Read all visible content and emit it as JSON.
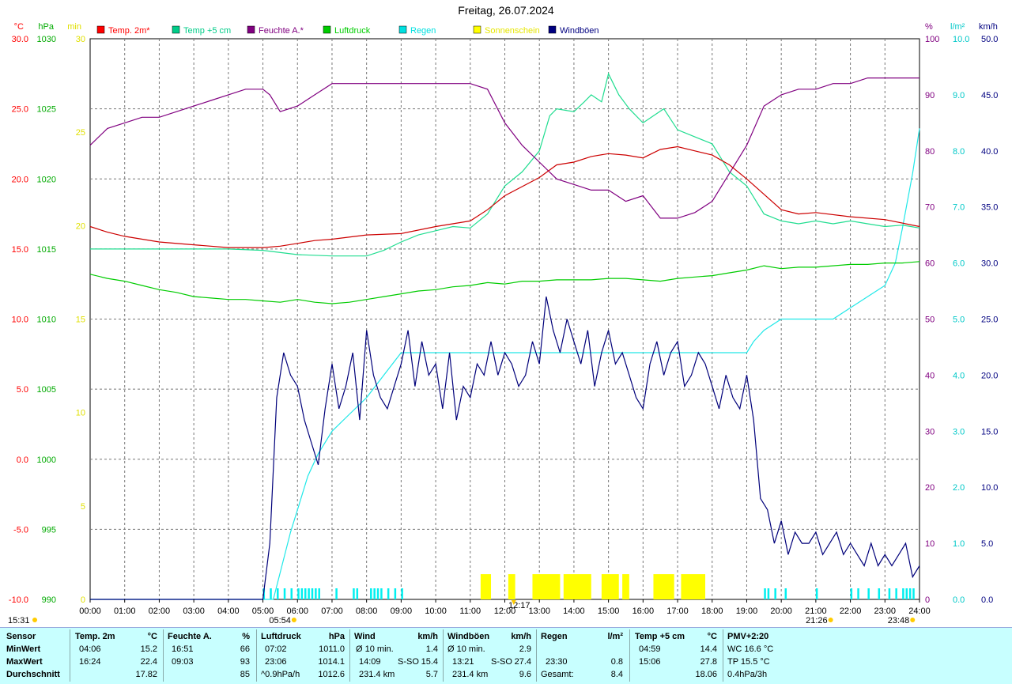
{
  "title": "Freitag, 26.07.2024",
  "chart_data": {
    "type": "line",
    "x_ticks": [
      "00:00",
      "01:00",
      "02:00",
      "03:00",
      "04:00",
      "05:00",
      "06:00",
      "07:00",
      "08:00",
      "09:00",
      "10:00",
      "11:00",
      "12:00",
      "13:00",
      "14:00",
      "15:00",
      "16:00",
      "17:00",
      "18:00",
      "19:00",
      "20:00",
      "21:00",
      "22:00",
      "23:00",
      "24:00"
    ],
    "axes": {
      "temp": {
        "unit": "°C",
        "color": "#ff0000",
        "min": -10,
        "max": 30,
        "step": 5,
        "ticks": [
          "-10.0",
          "-5.0",
          "0.0",
          "5.0",
          "10.0",
          "15.0",
          "20.0",
          "25.0",
          "30.0"
        ]
      },
      "pressure": {
        "unit": "hPa",
        "color": "#00aa00",
        "min": 990,
        "max": 1030,
        "step": 5,
        "ticks": [
          "990",
          "995",
          "1000",
          "1005",
          "1010",
          "1015",
          "1020",
          "1025",
          "1030"
        ]
      },
      "sun": {
        "unit": "min",
        "color": "#ffff00",
        "min": 0,
        "max": 30,
        "step": 5,
        "ticks": [
          "0",
          "5",
          "10",
          "15",
          "20",
          "25",
          "30"
        ]
      },
      "humidity": {
        "unit": "%",
        "color": "#800080",
        "min": 0,
        "max": 100,
        "step": 10,
        "ticks": [
          "0",
          "10",
          "20",
          "30",
          "40",
          "50",
          "60",
          "70",
          "80",
          "90",
          "100"
        ]
      },
      "rain": {
        "unit": "l/m²",
        "color": "#00e0e0",
        "min": 0,
        "max": 10,
        "step": 1,
        "ticks": [
          "0.0",
          "1.0",
          "2.0",
          "3.0",
          "4.0",
          "5.0",
          "6.0",
          "7.0",
          "8.0",
          "9.0",
          "10.0"
        ]
      },
      "wind": {
        "unit": "km/h",
        "color": "#000080",
        "min": 0,
        "max": 50,
        "step": 5,
        "ticks": [
          "0.0",
          "5.0",
          "10.0",
          "15.0",
          "20.0",
          "25.0",
          "30.0",
          "35.0",
          "40.0",
          "45.0",
          "50.0"
        ]
      }
    },
    "legend": [
      {
        "name": "Temp. 2m*",
        "color": "#ff0000"
      },
      {
        "name": "Temp +5 cm",
        "color": "#00cc88"
      },
      {
        "name": "Feuchte A.*",
        "color": "#800080"
      },
      {
        "name": "Luftdruck",
        "color": "#00cc00"
      },
      {
        "name": "Regen",
        "color": "#00e0e0"
      },
      {
        "name": "Sonnenschein",
        "color": "#ffff00"
      },
      {
        "name": "Windböen",
        "color": "#000080"
      }
    ],
    "series": {
      "temp2m": {
        "axis": "temp",
        "color": "#cc0000",
        "x": [
          0,
          0.5,
          1,
          2,
          3,
          4,
          4.5,
          5,
          5.5,
          6,
          6.5,
          7,
          8,
          9,
          10,
          11,
          11.5,
          12,
          13,
          13.5,
          14,
          14.5,
          15,
          15.5,
          16,
          16.5,
          17,
          17.5,
          18,
          18.5,
          19,
          19.5,
          20,
          20.5,
          21,
          22,
          23,
          24
        ],
        "y": [
          16.6,
          16.2,
          15.9,
          15.5,
          15.3,
          15.1,
          15.1,
          15.1,
          15.2,
          15.4,
          15.6,
          15.7,
          16.0,
          16.1,
          16.6,
          17.0,
          17.8,
          18.8,
          20.1,
          21.0,
          21.2,
          21.6,
          21.8,
          21.7,
          21.5,
          22.1,
          22.3,
          22.0,
          21.7,
          21.0,
          20.0,
          18.9,
          17.8,
          17.5,
          17.6,
          17.3,
          17.1,
          16.6
        ]
      },
      "temp5cm": {
        "axis": "temp",
        "color": "#20dd90",
        "x": [
          0,
          1,
          2,
          3,
          4,
          5,
          6,
          7,
          8,
          8.5,
          9,
          9.5,
          10,
          10.5,
          11,
          11.5,
          12,
          12.5,
          13,
          13.3,
          13.5,
          14,
          14.3,
          14.5,
          14.8,
          15,
          15.3,
          15.6,
          16,
          16.3,
          16.6,
          17,
          17.5,
          18,
          18.5,
          19,
          19.5,
          20,
          20.5,
          21,
          21.5,
          22,
          22.5,
          23,
          23.5,
          24
        ],
        "y": [
          15.0,
          15.0,
          15.0,
          15.0,
          15.0,
          14.9,
          14.6,
          14.5,
          14.5,
          14.9,
          15.5,
          16.0,
          16.3,
          16.6,
          16.5,
          17.5,
          19.5,
          20.5,
          22.0,
          24.5,
          25.0,
          24.8,
          25.5,
          26.0,
          25.5,
          27.5,
          26.0,
          25.0,
          24.0,
          24.5,
          25.0,
          23.5,
          23.0,
          22.5,
          20.5,
          19.5,
          17.5,
          17.0,
          16.8,
          17.0,
          16.8,
          17.0,
          16.8,
          16.6,
          16.7,
          16.5
        ]
      },
      "humidity": {
        "axis": "humidity",
        "color": "#800080",
        "x": [
          0,
          0.5,
          1,
          1.5,
          2,
          2.5,
          3,
          3.5,
          4,
          4.5,
          5,
          5.2,
          5.5,
          6,
          6.5,
          7,
          7.5,
          8,
          8.5,
          9,
          9.5,
          10,
          10.5,
          11,
          11.5,
          12,
          12.5,
          13,
          13.5,
          14,
          14.5,
          15,
          15.5,
          16,
          16.5,
          17,
          17.5,
          18,
          18.5,
          19,
          19.5,
          20,
          20.5,
          21,
          21.5,
          22,
          22.5,
          23,
          23.5,
          24
        ],
        "y": [
          81,
          84,
          85,
          86,
          86,
          87,
          88,
          89,
          90,
          91,
          91,
          90,
          87,
          88,
          90,
          92,
          92,
          92,
          92,
          92,
          92,
          92,
          92,
          92,
          91,
          85,
          81,
          78,
          75,
          74,
          73,
          73,
          71,
          72,
          68,
          68,
          69,
          71,
          76,
          81,
          88,
          90,
          91,
          91,
          92,
          92,
          93,
          93,
          93,
          93
        ]
      },
      "pressure": {
        "axis": "pressure",
        "color": "#00cc00",
        "x": [
          0,
          0.5,
          1,
          1.5,
          2,
          2.5,
          3,
          3.5,
          4,
          4.5,
          5,
          5.5,
          6,
          6.5,
          7,
          7.5,
          8,
          8.5,
          9,
          9.5,
          10,
          10.5,
          11,
          11.5,
          12,
          12.5,
          13,
          13.5,
          14,
          14.5,
          15,
          15.5,
          16,
          16.5,
          17,
          17.5,
          18,
          18.5,
          19,
          19.5,
          20,
          20.5,
          21,
          21.5,
          22,
          22.5,
          23,
          23.5,
          24
        ],
        "y": [
          1013.2,
          1012.9,
          1012.7,
          1012.4,
          1012.1,
          1011.9,
          1011.6,
          1011.5,
          1011.4,
          1011.4,
          1011.3,
          1011.2,
          1011.4,
          1011.2,
          1011.1,
          1011.2,
          1011.4,
          1011.6,
          1011.8,
          1012.0,
          1012.1,
          1012.3,
          1012.4,
          1012.6,
          1012.5,
          1012.7,
          1012.7,
          1012.8,
          1012.8,
          1012.8,
          1012.9,
          1012.9,
          1012.8,
          1012.7,
          1012.9,
          1013.0,
          1013.1,
          1013.3,
          1013.5,
          1013.8,
          1013.6,
          1013.7,
          1013.7,
          1013.8,
          1013.9,
          1013.9,
          1014.0,
          1014.0,
          1014.1
        ]
      },
      "rain": {
        "axis": "rain",
        "color": "#20e8e8",
        "x": [
          0,
          5.3,
          5.8,
          6,
          6.3,
          6.6,
          7,
          7.5,
          8,
          8.5,
          9,
          11,
          12,
          14,
          16,
          17,
          18,
          19,
          19.2,
          19.5,
          20,
          20.5,
          21,
          21.5,
          22,
          22.5,
          23,
          23.3,
          23.5,
          23.8,
          24
        ],
        "y": [
          0,
          0,
          1.2,
          1.6,
          2.2,
          2.6,
          3.0,
          3.3,
          3.6,
          4.0,
          4.4,
          4.4,
          4.4,
          4.4,
          4.4,
          4.4,
          4.4,
          4.4,
          4.6,
          4.8,
          5.0,
          5.0,
          5.0,
          5.0,
          5.2,
          5.4,
          5.6,
          6.0,
          6.6,
          7.6,
          8.4
        ]
      },
      "wind": {
        "axis": "wind",
        "color": "#00007a",
        "x": [
          0,
          5,
          5.2,
          5.4,
          5.6,
          5.8,
          6,
          6.2,
          6.4,
          6.6,
          6.8,
          7,
          7.2,
          7.4,
          7.6,
          7.8,
          8,
          8.2,
          8.4,
          8.6,
          8.8,
          9,
          9.2,
          9.4,
          9.6,
          9.8,
          10,
          10.2,
          10.4,
          10.6,
          10.8,
          11,
          11.2,
          11.4,
          11.6,
          11.8,
          12,
          12.2,
          12.4,
          12.6,
          12.8,
          13,
          13.2,
          13.4,
          13.6,
          13.8,
          14,
          14.2,
          14.4,
          14.6,
          14.8,
          15,
          15.2,
          15.4,
          15.6,
          15.8,
          16,
          16.2,
          16.4,
          16.6,
          16.8,
          17,
          17.2,
          17.4,
          17.6,
          17.8,
          18,
          18.2,
          18.4,
          18.6,
          18.8,
          19,
          19.2,
          19.4,
          19.6,
          19.8,
          20,
          20.2,
          20.4,
          20.6,
          20.8,
          21,
          21.2,
          21.4,
          21.6,
          21.8,
          22,
          22.2,
          22.4,
          22.6,
          22.8,
          23,
          23.2,
          23.4,
          23.6,
          23.8,
          24
        ],
        "y": [
          0,
          0,
          5,
          18,
          22,
          20,
          19,
          16,
          14,
          12,
          17,
          21,
          17,
          19,
          22,
          16,
          24,
          20,
          18,
          17,
          19,
          21,
          24,
          19,
          23,
          20,
          21,
          17,
          22,
          16,
          19,
          18,
          21,
          20,
          23,
          20,
          22,
          21,
          19,
          20,
          23,
          21,
          27,
          24,
          22,
          25,
          23,
          21,
          24,
          19,
          22,
          24,
          21,
          22,
          20,
          18,
          17,
          21,
          23,
          20,
          22,
          23,
          19,
          20,
          22,
          21,
          19,
          17,
          20,
          18,
          17,
          20,
          16,
          9,
          8,
          5,
          7,
          4,
          6,
          5,
          5,
          6,
          4,
          5,
          6,
          4,
          5,
          4,
          3,
          5,
          3,
          4,
          3,
          4,
          5,
          2,
          3,
          2
        ]
      }
    },
    "sunshine_intervals": [
      [
        11.3,
        11.6
      ],
      [
        12.1,
        12.3
      ],
      [
        12.8,
        13.6
      ],
      [
        13.7,
        14.5
      ],
      [
        14.8,
        15.3
      ],
      [
        15.4,
        15.6
      ],
      [
        16.3,
        16.9
      ],
      [
        17.1,
        17.8
      ]
    ],
    "rain_ticks": [
      5.0,
      5.2,
      5.4,
      5.6,
      5.8,
      6.0,
      6.1,
      6.2,
      6.3,
      6.4,
      6.5,
      6.6,
      7.1,
      7.6,
      7.7,
      8.1,
      8.2,
      8.3,
      8.4,
      8.6,
      8.8,
      9.0,
      19.5,
      19.6,
      19.8,
      20.1,
      21.0,
      22.0,
      22.2,
      22.5,
      22.8,
      23.1,
      23.3,
      23.5,
      23.6,
      23.7,
      23.8
    ],
    "x_annotations": [
      {
        "label": "15:31",
        "x": 0,
        "row": "left"
      },
      {
        "label": "05:54",
        "x": 5.9,
        "row": "bottom"
      },
      {
        "label": "12:17",
        "x": 12.28,
        "row": "top"
      },
      {
        "label": "21:26",
        "x": 21.43,
        "row": "bottom"
      },
      {
        "label": "23:48",
        "x": 23.8,
        "row": "bottom"
      }
    ]
  },
  "stats": {
    "row_labels": {
      "sensor": "Sensor",
      "min": "MinWert",
      "max": "MaxWert",
      "avg": "Durchschnitt"
    },
    "temp2m": {
      "title": "Temp. 2m",
      "unit": "°C",
      "min_time": "04:06",
      "min": "15.2",
      "max_time": "16:24",
      "max": "22.4",
      "avg": "17.82"
    },
    "humidity": {
      "title": "Feuchte A.",
      "unit": "%",
      "min_time": "16:51",
      "min": "66",
      "max_time": "09:03",
      "max": "93",
      "avg": "85"
    },
    "pressure": {
      "title": "Luftdruck",
      "unit": "hPa",
      "min_time": "07:02",
      "min": "1011.0",
      "max_time": "23:06",
      "max": "1014.1",
      "avg_label": "^0.9hPa/h",
      "avg": "1012.6"
    },
    "wind": {
      "title": "Wind",
      "unit": "km/h",
      "min_label": "Ø 10 min.",
      "min": "1.4",
      "max_time": "14:09",
      "max_dir": "S-SO",
      "max": "15.4",
      "avg_label": "231.4 km",
      "avg": "5.7"
    },
    "gusts": {
      "title": "Windböen",
      "unit": "km/h",
      "min_label": "Ø 10 min.",
      "min": "2.9",
      "max_time": "13:21",
      "max_dir": "S-SO",
      "max": "27.4",
      "avg_label": "231.4 km",
      "avg": "9.6"
    },
    "rain": {
      "title": "Regen",
      "unit": "l/m²",
      "max_time": "23:30",
      "max": "0.8",
      "avg_label": "Gesamt:",
      "avg": "8.4"
    },
    "temp5cm": {
      "title": "Temp +5 cm",
      "unit": "°C",
      "min_time": "04:59",
      "min": "14.4",
      "max_time": "15:06",
      "max": "27.8",
      "avg": "18.06"
    },
    "pmv": {
      "title": "PMV+2:20",
      "line1": "WC 16.6 °C",
      "line2": "TP 15.5 °C",
      "line3": "0.4hPa/3h"
    }
  }
}
